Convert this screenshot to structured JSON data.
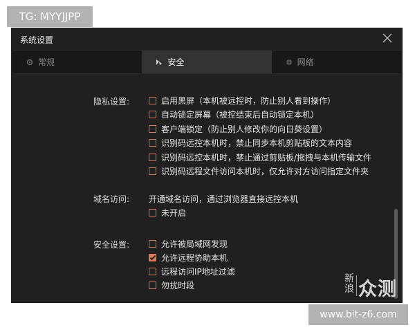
{
  "overlay_tag": "TG: MYYJJPP",
  "url_badge": "www.bit-z6.com",
  "window": {
    "title": "系统设置"
  },
  "tabs": [
    {
      "label": "常规",
      "icon": "gear-icon",
      "active": false
    },
    {
      "label": "安全",
      "icon": "security-icon",
      "active": true
    },
    {
      "label": "网络",
      "icon": "globe-icon",
      "active": false
    }
  ],
  "privacy": {
    "label": "隐私设置:",
    "items": [
      {
        "label": "启用黑屏（本机被远控时，防止别人看到操作）",
        "checked": false
      },
      {
        "label": "自动锁定屏幕（被控结束后自动锁定本机）",
        "checked": false
      },
      {
        "label": "客户端锁定（防止别人修改你的向日葵设置）",
        "checked": false
      },
      {
        "label": "识别码远控本机时，禁止同步本机剪贴板的文本内容",
        "checked": false
      },
      {
        "label": "识别码远控本机时，禁止通过剪贴板/拖拽与本机传输文件",
        "checked": false
      },
      {
        "label": "识别码远程文件访问本机时，仅允许对方访问指定文件夹",
        "checked": false
      }
    ]
  },
  "domain": {
    "label": "域名访问:",
    "description": "开通域名访问，通过浏览器直接远控本机",
    "items": [
      {
        "label": "未开启",
        "checked": false
      }
    ]
  },
  "security": {
    "label": "安全设置:",
    "items": [
      {
        "label": "允许被局域网发现",
        "checked": false
      },
      {
        "label": "允许远程协助本机",
        "checked": true
      },
      {
        "label": "远程访问IP地址过滤",
        "checked": false
      },
      {
        "label": "勿扰时段",
        "checked": false
      }
    ]
  },
  "watermark": {
    "small": "新浪",
    "big": "众测"
  },
  "colors": {
    "accent": "#e0795a",
    "window_bg": "#202020",
    "tab_active": "#323232"
  }
}
